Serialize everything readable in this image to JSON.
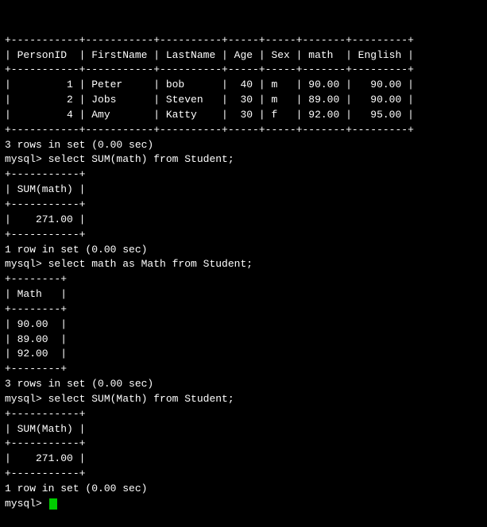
{
  "terminal": {
    "lines": [
      "+-----------+-----------+----------+-----+-----+-------+---------+",
      "| PersonID  | FirstName | LastName | Age | Sex | math  | English |",
      "+-----------+-----------+----------+-----+-----+-------+---------+",
      "|         1 | Peter     | bob      |  40 | m   | 90.00 |   90.00 |",
      "|         2 | Jobs      | Steven   |  30 | m   | 89.00 |   90.00 |",
      "|         4 | Amy       | Katty    |  30 | f   | 92.00 |   95.00 |",
      "+-----------+-----------+----------+-----+-----+-------+---------+",
      "3 rows in set (0.00 sec)",
      "",
      "mysql> select SUM(math) from Student;",
      "+-----------+",
      "| SUM(math) |",
      "+-----------+",
      "|    271.00 |",
      "+-----------+",
      "1 row in set (0.00 sec)",
      "",
      "mysql> select math as Math from Student;",
      "+--------+",
      "| Math   |",
      "+--------+",
      "| 90.00  |",
      "| 89.00  |",
      "| 92.00  |",
      "+--------+",
      "3 rows in set (0.00 sec)",
      "",
      "mysql> select SUM(Math) from Student;",
      "+-----------+",
      "| SUM(Math) |",
      "+-----------+",
      "|    271.00 |",
      "+-----------+",
      "1 row in set (0.00 sec)",
      "",
      "mysql> "
    ],
    "prompt_label": "mysql> "
  }
}
